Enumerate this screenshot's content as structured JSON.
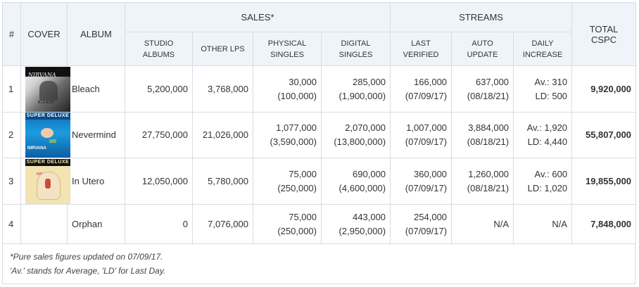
{
  "headers": {
    "idx": "#",
    "cover": "COVER",
    "album": "ALBUM",
    "sales_group": "SALES*",
    "streams_group": "STREAMS",
    "total": "TOTAL CSPC",
    "studio_albums": "STUDIO ALBUMS",
    "other_lps": "OTHER LPS",
    "physical_singles": "PHYSICAL SINGLES",
    "digital_singles": "DIGITAL SINGLES",
    "last_verified": "LAST VERIFIED",
    "auto_update": "AUTO UPDATE",
    "daily_increase": "DAILY INCREASE"
  },
  "rows": [
    {
      "idx": "1",
      "album": "Bleach",
      "cover": {
        "head": "NIRVANA",
        "tag": "BLEACH"
      },
      "studio_albums": "5,200,000",
      "other_lps": "3,768,000",
      "physical_singles": "30,000",
      "physical_singles_paren": "(100,000)",
      "digital_singles": "285,000",
      "digital_singles_paren": "(1,900,000)",
      "last_verified": "166,000",
      "last_verified_date": "(07/09/17)",
      "auto_update": "637,000",
      "auto_update_date": "(08/18/21)",
      "daily_avg": "Av.: 310",
      "daily_ld": "LD: 500",
      "total": "9,920,000"
    },
    {
      "idx": "2",
      "album": "Nevermind",
      "cover": {
        "head": "SUPER DELUXE",
        "tag": "NIRVANA"
      },
      "studio_albums": "27,750,000",
      "other_lps": "21,026,000",
      "physical_singles": "1,077,000",
      "physical_singles_paren": "(3,590,000)",
      "digital_singles": "2,070,000",
      "digital_singles_paren": "(13,800,000)",
      "last_verified": "1,007,000",
      "last_verified_date": "(07/09/17)",
      "auto_update": "3,884,000",
      "auto_update_date": "(08/18/21)",
      "daily_avg": "Av.: 1,920",
      "daily_ld": "LD: 4,440",
      "total": "55,807,000"
    },
    {
      "idx": "3",
      "album": "In Utero",
      "cover": {
        "head": "SUPER DELUXE",
        "tag": "NIRVANA"
      },
      "studio_albums": "12,050,000",
      "other_lps": "5,780,000",
      "physical_singles": "75,000",
      "physical_singles_paren": "(250,000)",
      "digital_singles": "690,000",
      "digital_singles_paren": "(4,600,000)",
      "last_verified": "360,000",
      "last_verified_date": "(07/09/17)",
      "auto_update": "1,260,000",
      "auto_update_date": "(08/18/21)",
      "daily_avg": "Av.: 600",
      "daily_ld": "LD: 1,020",
      "total": "19,855,000"
    },
    {
      "idx": "4",
      "album": "Orphan",
      "studio_albums": "0",
      "other_lps": "7,076,000",
      "physical_singles": "75,000",
      "physical_singles_paren": "(250,000)",
      "digital_singles": "443,000",
      "digital_singles_paren": "(2,950,000)",
      "last_verified": "254,000",
      "last_verified_date": "(07/09/17)",
      "auto_update": "N/A",
      "daily_na": "N/A",
      "total": "7,848,000"
    }
  ],
  "footnotes": {
    "line1": "*Pure sales figures updated on 07/09/17.",
    "line2": "'Av.' stands for Average, 'LD' for Last Day."
  },
  "colors": {
    "header_bg": "#eef4fa",
    "border": "#d7dde3"
  }
}
